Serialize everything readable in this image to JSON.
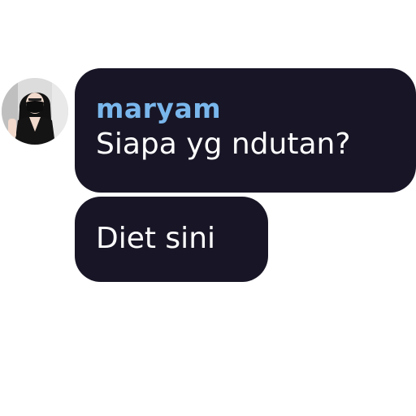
{
  "avatar": {
    "icon": "user-photo-avatar"
  },
  "messages": [
    {
      "sender": "maryam",
      "text": "Siapa yg ndutan?"
    },
    {
      "text": "Diet sini"
    }
  ],
  "colors": {
    "bubble": "#181626",
    "sender_name": "#79b6ec",
    "message_text": "#ffffff",
    "background": "#ffffff"
  }
}
